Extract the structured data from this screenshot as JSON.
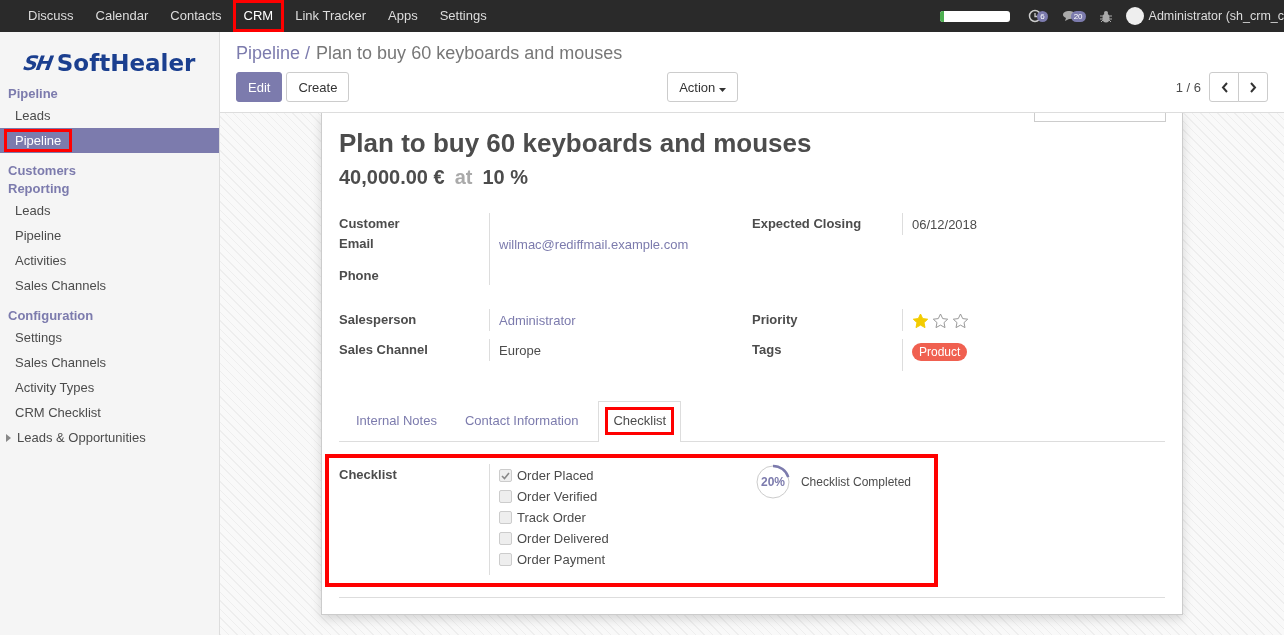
{
  "top_menu": [
    {
      "label": "Discuss",
      "highlighted": false
    },
    {
      "label": "Calendar",
      "highlighted": false
    },
    {
      "label": "Contacts",
      "highlighted": false
    },
    {
      "label": "CRM",
      "highlighted": true
    },
    {
      "label": "Link Tracker",
      "highlighted": false
    },
    {
      "label": "Apps",
      "highlighted": false
    },
    {
      "label": "Settings",
      "highlighted": false
    }
  ],
  "systray": {
    "progress": {
      "level": 0.05
    },
    "activity_count": "6",
    "message_count": "20",
    "user": "Administrator (sh_crm_c"
  },
  "logo": {
    "mark": "SH",
    "name": "SoftHealer"
  },
  "sidebar": [
    {
      "kind": "header",
      "label": "Pipeline"
    },
    {
      "kind": "item",
      "label": "Leads",
      "selected": false,
      "highlighted": false
    },
    {
      "kind": "item",
      "label": "Pipeline",
      "selected": true,
      "highlighted": true
    },
    {
      "kind": "header",
      "label": "Customers"
    },
    {
      "kind": "header",
      "label": "Reporting"
    },
    {
      "kind": "item",
      "label": "Leads",
      "selected": false,
      "highlighted": false
    },
    {
      "kind": "item",
      "label": "Pipeline",
      "selected": false,
      "highlighted": false
    },
    {
      "kind": "item",
      "label": "Activities",
      "selected": false,
      "highlighted": false
    },
    {
      "kind": "item",
      "label": "Sales Channels",
      "selected": false,
      "highlighted": false
    },
    {
      "kind": "header",
      "label": "Configuration"
    },
    {
      "kind": "item",
      "label": "Settings",
      "selected": false,
      "highlighted": false
    },
    {
      "kind": "item",
      "label": "Sales Channels",
      "selected": false,
      "highlighted": false
    },
    {
      "kind": "item",
      "label": "Activity Types",
      "selected": false,
      "highlighted": false
    },
    {
      "kind": "item",
      "label": "CRM Checklist",
      "selected": false,
      "highlighted": false
    },
    {
      "kind": "folder",
      "label": "Leads & Opportunities",
      "expanded": false
    }
  ],
  "breadcrumb": {
    "parent": "Pipeline /",
    "current": "Plan to buy 60 keyboards and mouses"
  },
  "buttons": {
    "edit": "Edit",
    "create": "Create",
    "action": "Action"
  },
  "pager": {
    "value": "1 / 6"
  },
  "record": {
    "title": "Plan to buy 60 keyboards and mouses",
    "revenue": "40,000.00 €",
    "at": "at",
    "probability": "10 %",
    "left_fields": [
      {
        "label": "Customer"
      },
      {
        "label": "Email",
        "value": "willmac@rediffmail.example.com",
        "kind": "link"
      },
      {
        "label": "Phone"
      }
    ],
    "right_fields": [
      {
        "label": "Expected Closing",
        "value": "06/12/2018"
      }
    ],
    "left_fields_2": [
      {
        "label": "Salesperson",
        "value": "Administrator",
        "kind": "link"
      },
      {
        "label": "Sales Channel",
        "value": "Europe",
        "kind": "text"
      }
    ],
    "priority": {
      "label": "Priority",
      "stars": 1
    },
    "tags": {
      "label": "Tags",
      "items": [
        {
          "label": "Product",
          "color": "#f06050"
        }
      ]
    }
  },
  "tabs": [
    {
      "label": "Internal Notes",
      "selected": false,
      "highlighted": false
    },
    {
      "label": "Contact Information",
      "selected": false,
      "highlighted": false
    },
    {
      "label": "Checklist",
      "selected": true,
      "highlighted": true
    }
  ],
  "checklist": {
    "label": "Checklist",
    "highlighted": true,
    "items": [
      {
        "label": "Order Placed",
        "checked": true
      },
      {
        "label": "Order Verified",
        "checked": false
      },
      {
        "label": "Track Order",
        "checked": false
      },
      {
        "label": "Order Delivered",
        "checked": false
      },
      {
        "label": "Order Payment",
        "checked": false
      }
    ],
    "progress": {
      "level": 0.2,
      "reading": "20%",
      "caption": "Checklist Completed"
    }
  }
}
